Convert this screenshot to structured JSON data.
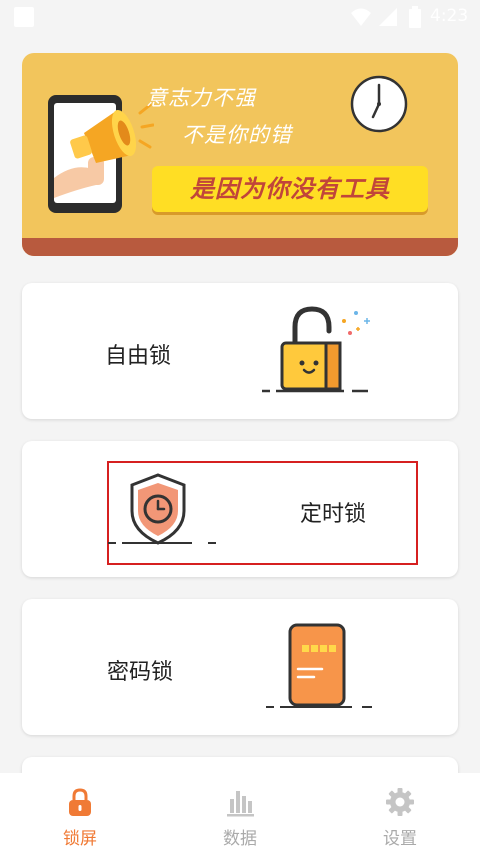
{
  "status_bar": {
    "time": "4:23"
  },
  "banner": {
    "line1": "意志力不强",
    "line2": "不是你的错",
    "highlight": "是因为你没有工具"
  },
  "cards": [
    {
      "label": "自由锁",
      "icon": "padlock-icon"
    },
    {
      "label": "定时锁",
      "icon": "shield-clock-icon"
    },
    {
      "label": "密码锁",
      "icon": "phone-icon"
    }
  ],
  "nav": {
    "items": [
      {
        "label": "锁屏",
        "icon": "lock-icon",
        "active": true
      },
      {
        "label": "数据",
        "icon": "bar-chart-icon",
        "active": false
      },
      {
        "label": "设置",
        "icon": "gear-icon",
        "active": false
      }
    ]
  },
  "colors": {
    "accent": "#f07a35",
    "banner_bg": "#f2c55c",
    "banner_band": "#b85a3e",
    "highlight_bg": "#ffde24",
    "highlight_text": "#c1453a",
    "selection_border": "#d62020"
  }
}
